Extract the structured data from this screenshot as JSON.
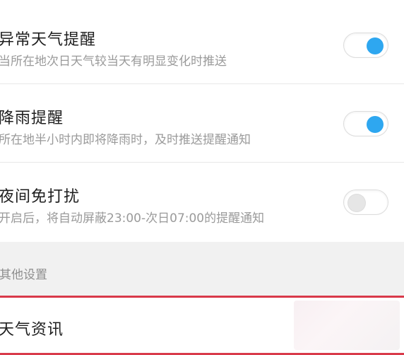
{
  "settings": [
    {
      "title": "异常天气提醒",
      "subtitle": "当所在地次日天气较当天有明显变化时推送",
      "enabled": true
    },
    {
      "title": "降雨提醒",
      "subtitle": "所在地半小时内即将降雨时，及时推送提醒通知",
      "enabled": true
    },
    {
      "title": "夜间免打扰",
      "subtitle": "开启后，将自动屏蔽23:00-次日07:00的提醒通知",
      "enabled": false
    }
  ],
  "other_section": {
    "label": "其他设置",
    "items": [
      {
        "title": "天气资讯"
      }
    ]
  },
  "colors": {
    "toggle_on": "#2ea7f0",
    "toggle_off": "#e6e6e6",
    "highlight_border": "#d93a4a"
  }
}
